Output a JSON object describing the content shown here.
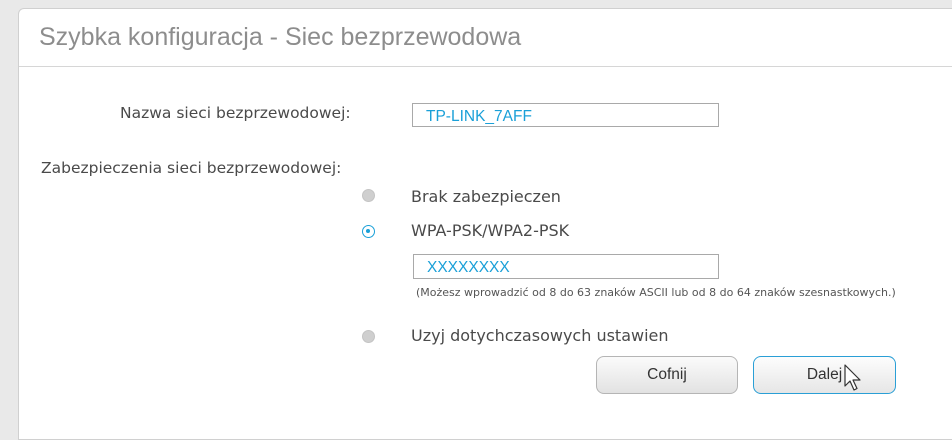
{
  "page": {
    "title": "Szybka konfiguracja - Siec bezprzewodowa"
  },
  "ssid": {
    "label": "Nazwa sieci bezprzewodowej:",
    "value": "TP-LINK_7AFF"
  },
  "security": {
    "label": "Zabezpieczenia sieci bezprzewodowej:",
    "options": [
      {
        "label": "Brak zabezpieczen",
        "selected": false
      },
      {
        "label": "WPA-PSK/WPA2-PSK",
        "selected": true
      },
      {
        "label": "Uzyj dotychczasowych ustawien",
        "selected": false
      }
    ],
    "password_value": "XXXXXXXX",
    "password_hint": "(Możesz wprowadzić od 8 do 63 znaków ASCII lub od 8 do 64 znaków szesnastkowych.)"
  },
  "buttons": {
    "back_label": "Cofnij",
    "next_label": "Dalej"
  },
  "colors": {
    "accent": "#1aa0d8",
    "title": "#8d8d8d"
  },
  "icons": {
    "cursor": "pointer-cursor-icon"
  }
}
